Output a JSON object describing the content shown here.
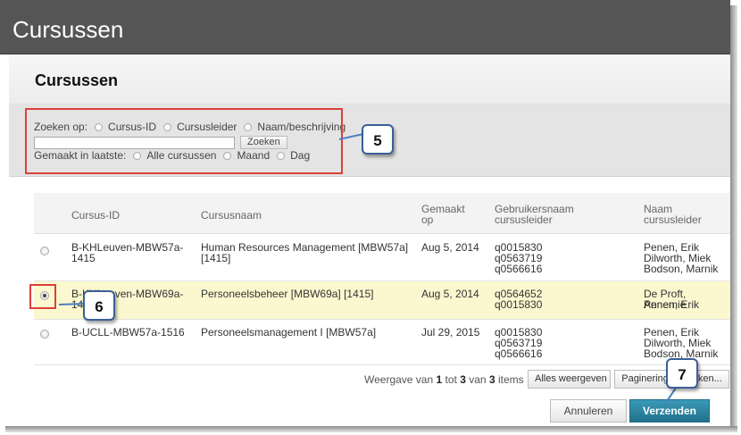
{
  "window": {
    "title": "Cursussen"
  },
  "header": {
    "title": "Cursussen"
  },
  "search": {
    "label": "Zoeken op:",
    "options": [
      "Cursus-ID",
      "Cursusleider",
      "Naam/beschrijving"
    ],
    "input_value": "",
    "button": "Zoeken",
    "created_label": "Gemaakt in laatste:",
    "created_options": [
      "Alle cursussen",
      "Maand",
      "Dag"
    ]
  },
  "table": {
    "columns": {
      "id": "Cursus-ID",
      "name": "Cursusnaam",
      "created_1": "Gemaakt",
      "created_2": "op",
      "user_1": "Gebruikersnaam",
      "user_2": "cursusleider",
      "leader_1": "Naam",
      "leader_2": "cursusleider"
    },
    "rows": [
      {
        "id_1": "B-KHLeuven-MBW57a-",
        "id_2": "1415",
        "name_1": "Human Resources Management [MBW57a]",
        "name_2": "[1415]",
        "created": "Aug 5, 2014",
        "users": [
          "q0015830",
          "q0563719",
          "q0566616"
        ],
        "leaders": [
          "Penen, Erik",
          "Dilworth, Miek",
          "Bodson, Marnik"
        ]
      },
      {
        "id_1": "B-KHLeuven-MBW69a-",
        "id_2": "1415",
        "name_1": "Personeelsbeheer [MBW69a] [1415]",
        "name_2": "",
        "created": "Aug 5, 2014",
        "users": [
          "q0564652",
          "q0015830"
        ],
        "leaders": [
          "De Proft, Annemie",
          "Penen, Erik"
        ]
      },
      {
        "id_1": "B-UCLL-MBW57a-1516",
        "id_2": "",
        "name_1": "Personeelsmanagement I [MBW57a]",
        "name_2": "",
        "created": "Jul 29, 2015",
        "users": [
          "q0015830",
          "q0563719",
          "q0566616"
        ],
        "leaders": [
          "Penen, Erik",
          "Dilworth, Miek",
          "Bodson, Marnik"
        ]
      }
    ]
  },
  "pagination": {
    "prefix": "Weergave van",
    "from": "1",
    "middle": "tot",
    "to": "3",
    "middle2": "van",
    "total": "3",
    "suffix": "items",
    "show_all": "Alles weergeven",
    "paging": "Paginering bewerken..."
  },
  "actions": {
    "cancel": "Annuleren",
    "submit": "Verzenden"
  },
  "callouts": [
    "5",
    "6",
    "7"
  ],
  "colors": {
    "submit_bg": "#2a7f9b",
    "selected_row": "#fbf8d0",
    "annotation_red": "#d9413a",
    "callout_border": "#3a5f95"
  }
}
